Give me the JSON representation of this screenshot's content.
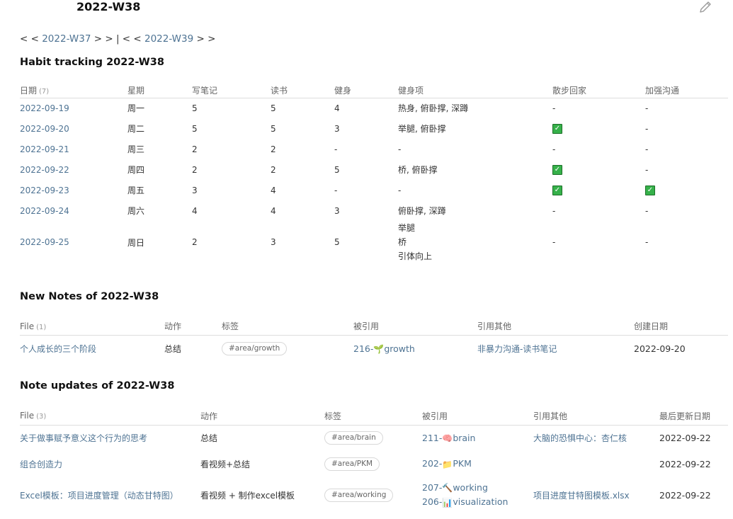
{
  "page": {
    "title": "2022-W38"
  },
  "weeknav": {
    "prev_open": "< <",
    "prev": "2022-W37",
    "sep": "> > | < <",
    "next": "2022-W39",
    "next_close": "> >"
  },
  "habit": {
    "title": "Habit tracking 2022-W38",
    "headers": [
      "日期",
      "星期",
      "写笔记",
      "读书",
      "健身",
      "健身项",
      "散步回家",
      "加强沟通"
    ],
    "count": "(7)",
    "rows": [
      {
        "date": "2022-09-19",
        "weekday": "周一",
        "notes": "5",
        "reading": "5",
        "fitness": "4",
        "items": [
          "热身, 俯卧撑, 深蹲"
        ],
        "walk": "-",
        "comm": "-"
      },
      {
        "date": "2022-09-20",
        "weekday": "周二",
        "notes": "5",
        "reading": "5",
        "fitness": "3",
        "items": [
          "举腿, 俯卧撑"
        ],
        "walk": "✓",
        "comm": "-"
      },
      {
        "date": "2022-09-21",
        "weekday": "周三",
        "notes": "2",
        "reading": "2",
        "fitness": "-",
        "items": [
          "-"
        ],
        "walk": "-",
        "comm": "-"
      },
      {
        "date": "2022-09-22",
        "weekday": "周四",
        "notes": "2",
        "reading": "2",
        "fitness": "5",
        "items": [
          "桥, 俯卧撑"
        ],
        "walk": "✓",
        "comm": "-"
      },
      {
        "date": "2022-09-23",
        "weekday": "周五",
        "notes": "3",
        "reading": "4",
        "fitness": "-",
        "items": [
          "-"
        ],
        "walk": "✓",
        "comm": "✓"
      },
      {
        "date": "2022-09-24",
        "weekday": "周六",
        "notes": "4",
        "reading": "4",
        "fitness": "3",
        "items": [
          "俯卧撑, 深蹲"
        ],
        "walk": "-",
        "comm": "-"
      },
      {
        "date": "2022-09-25",
        "weekday": "周日",
        "notes": "2",
        "reading": "3",
        "fitness": "5",
        "items": [
          "举腿",
          "桥",
          "引体向上"
        ],
        "walk": "-",
        "comm": "-"
      }
    ]
  },
  "new_notes": {
    "title": "New Notes of 2022-W38",
    "headers": [
      "File",
      "动作",
      "标签",
      "被引用",
      "引用其他",
      "创建日期"
    ],
    "count": "(1)",
    "rows": [
      {
        "file": "个人成长的三个阶段",
        "action": "总结",
        "tag": "#area/growth",
        "refs": [
          {
            "num": "216-",
            "emoji": "🌱",
            "name": "growth"
          }
        ],
        "cites": "非暴力沟通-读书笔记",
        "date": "2022-09-20"
      }
    ]
  },
  "updates": {
    "title": "Note updates of 2022-W38",
    "headers": [
      "File",
      "动作",
      "标签",
      "被引用",
      "引用其他",
      "最后更新日期"
    ],
    "count": "(3)",
    "rows": [
      {
        "file": "关于做事赋予意义这个行为的思考",
        "action": "总结",
        "tag": "#area/brain",
        "refs": [
          {
            "num": "211-",
            "emoji": "🧠",
            "name": "brain"
          }
        ],
        "cites": "大脑的恐惧中心：杏仁核",
        "date": "2022-09-22"
      },
      {
        "file": "组合创造力",
        "action": "看视频+总结",
        "tag": "#area/PKM",
        "refs": [
          {
            "num": "202-",
            "emoji": "📁",
            "name": "PKM"
          }
        ],
        "cites": "",
        "date": "2022-09-22"
      },
      {
        "file": "Excel模板：项目进度管理（动态甘特图）",
        "action": "看视频 + 制作excel模板",
        "tag": "#area/working",
        "refs": [
          {
            "num": "207-",
            "emoji": "🔨",
            "name": "working"
          },
          {
            "num": "206-",
            "emoji": "📊",
            "name": "visualization"
          }
        ],
        "cites": "项目进度甘特图模板.xlsx",
        "date": "2022-09-22"
      }
    ]
  }
}
